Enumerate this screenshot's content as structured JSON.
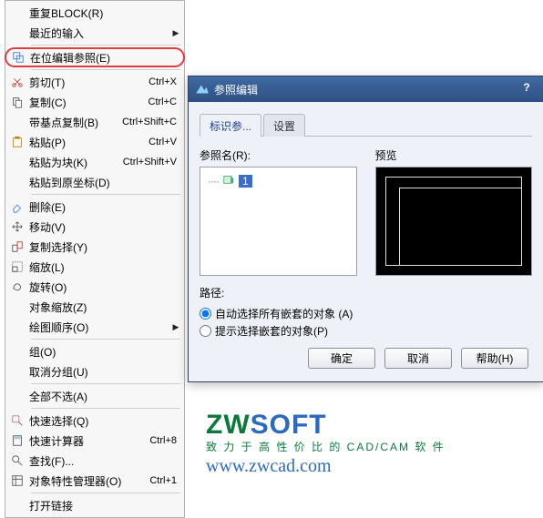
{
  "menu": {
    "repeat_block": "重复BLOCK(R)",
    "recent_input": "最近的输入",
    "edit_ref_inplace": "在位编辑参照(E)",
    "cut": "剪切(T)",
    "cut_sc": "Ctrl+X",
    "copy": "复制(C)",
    "copy_sc": "Ctrl+C",
    "copy_base": "带基点复制(B)",
    "copy_base_sc": "Ctrl+Shift+C",
    "paste": "粘贴(P)",
    "paste_sc": "Ctrl+V",
    "paste_block": "粘贴为块(K)",
    "paste_block_sc": "Ctrl+Shift+V",
    "paste_origin": "粘贴到原坐标(D)",
    "delete": "删除(E)",
    "move": "移动(V)",
    "copy_selection": "复制选择(Y)",
    "scale": "缩放(L)",
    "rotate": "旋转(O)",
    "object_zoom": "对象缩放(Z)",
    "draw_order": "绘图顺序(O)",
    "group": "组(O)",
    "ungroup": "取消分组(U)",
    "deselect_all": "全部不选(A)",
    "quick_select": "快速选择(Q)",
    "quick_calc": "快速计算器",
    "quick_calc_sc": "Ctrl+8",
    "find": "查找(F)...",
    "properties": "对象特性管理器(O)",
    "properties_sc": "Ctrl+1",
    "open_link": "打开链接"
  },
  "dialog": {
    "title": "参照编辑",
    "tab_identify": "标识参...",
    "tab_settings": "设置",
    "ref_name_label": "参照名(R):",
    "preview_label": "预览",
    "tree_node": "1",
    "path_label": "路径:",
    "radio_auto": "自动选择所有嵌套的对象 (A)",
    "radio_prompt": "提示选择嵌套的对象(P)",
    "btn_ok": "确定",
    "btn_cancel": "取消",
    "btn_help": "帮助(H)"
  },
  "logo": {
    "brand_zw": "ZW",
    "brand_soft": "SOFT",
    "tagline": "致 力 于 高 性 价 比 的 CAD/CAM 软 件",
    "url": "www.zwcad.com"
  }
}
